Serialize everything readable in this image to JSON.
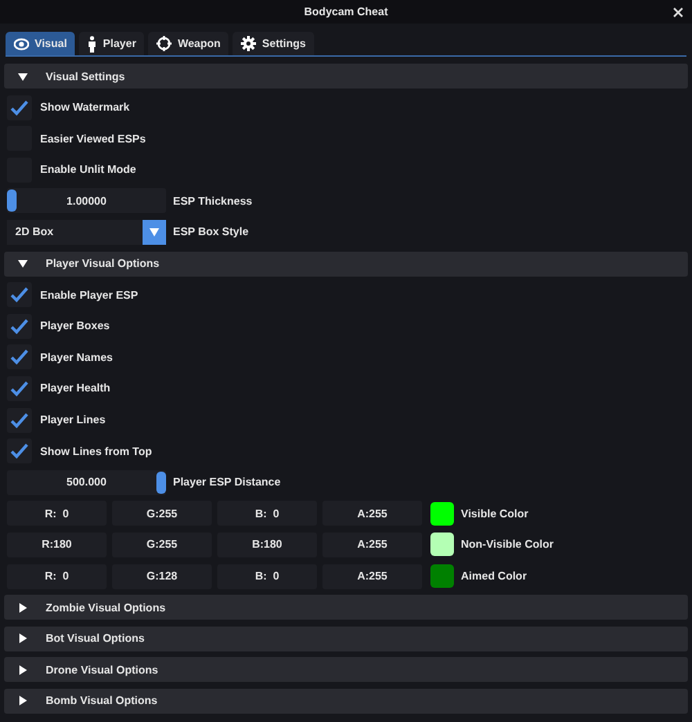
{
  "window": {
    "title": "Bodycam Cheat"
  },
  "tabs": [
    {
      "label": "Visual",
      "selected": true
    },
    {
      "label": "Player",
      "selected": false
    },
    {
      "label": "Weapon",
      "selected": false
    },
    {
      "label": "Settings",
      "selected": false
    }
  ],
  "sections": [
    {
      "title": "Visual Settings",
      "expanded": true,
      "items": [
        {
          "kind": "checkbox",
          "label": "Show Watermark",
          "checked": true
        },
        {
          "kind": "checkbox",
          "label": "Easier Viewed ESPs",
          "checked": false
        },
        {
          "kind": "checkbox",
          "label": "Enable Unlit Mode",
          "checked": false
        },
        {
          "kind": "slider",
          "label": "ESP Thickness",
          "reading": "1.00000",
          "level": 0
        },
        {
          "kind": "combo",
          "label": "ESP Box Style",
          "value": "2D Box"
        }
      ]
    },
    {
      "title": "Player Visual Options",
      "expanded": true,
      "items": [
        {
          "kind": "checkbox",
          "label": "Enable Player ESP",
          "checked": true
        },
        {
          "kind": "checkbox",
          "label": "Player Boxes",
          "checked": true
        },
        {
          "kind": "checkbox",
          "label": "Player Names",
          "checked": true
        },
        {
          "kind": "checkbox",
          "label": "Player Health",
          "checked": true
        },
        {
          "kind": "checkbox",
          "label": "Player Lines",
          "checked": true
        },
        {
          "kind": "checkbox",
          "label": "Show Lines from Top",
          "checked": true
        },
        {
          "kind": "slider",
          "label": "Player ESP Distance",
          "reading": "500.000",
          "level": 1
        },
        {
          "kind": "color",
          "channels": [
            "R:  0",
            "G:255",
            "B:  0",
            "A:255"
          ],
          "color": "#00ff00",
          "label": "Visible Color"
        },
        {
          "kind": "color",
          "channels": [
            "R:180",
            "G:255",
            "B:180",
            "A:255"
          ],
          "color": "#b4ffb4",
          "label": "Non-Visible Color"
        },
        {
          "kind": "color",
          "channels": [
            "R:  0",
            "G:128",
            "B:  0",
            "A:255"
          ],
          "color": "#008000",
          "label": "Aimed Color"
        }
      ]
    },
    {
      "title": "Zombie Visual Options",
      "expanded": false
    },
    {
      "title": "Bot Visual Options",
      "expanded": false
    },
    {
      "title": "Drone Visual Options",
      "expanded": false
    },
    {
      "title": "Bomb Visual Options",
      "expanded": false
    }
  ]
}
